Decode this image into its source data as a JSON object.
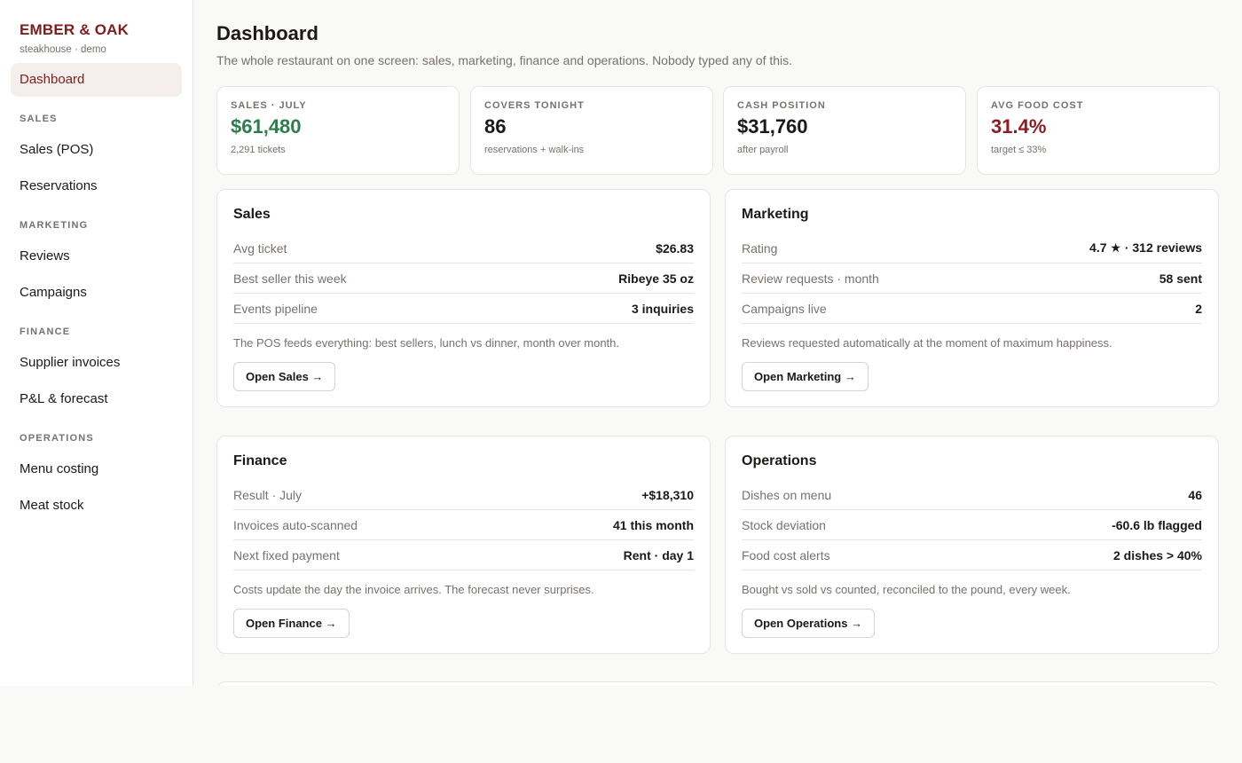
{
  "brand": {
    "name": "EMBER & OAK",
    "subtitle": "steakhouse · demo"
  },
  "sidebar": {
    "dashboard": "Dashboard",
    "sections": [
      {
        "title": "SALES",
        "items": [
          "Sales (POS)",
          "Reservations"
        ]
      },
      {
        "title": "MARKETING",
        "items": [
          "Reviews",
          "Campaigns"
        ]
      },
      {
        "title": "FINANCE",
        "items": [
          "Supplier invoices",
          "P&L & forecast"
        ]
      },
      {
        "title": "OPERATIONS",
        "items": [
          "Menu costing",
          "Meat stock"
        ]
      }
    ]
  },
  "page": {
    "title": "Dashboard",
    "subtitle": "The whole restaurant on one screen: sales, marketing, finance and operations. Nobody typed any of this."
  },
  "kpis": [
    {
      "label": "SALES · JULY",
      "value": "$61,480",
      "sub": "2,291 tickets",
      "tone": "green"
    },
    {
      "label": "COVERS TONIGHT",
      "value": "86",
      "sub": "reservations + walk-ins",
      "tone": "neutral"
    },
    {
      "label": "CASH POSITION",
      "value": "$31,760",
      "sub": "after payroll",
      "tone": "neutral"
    },
    {
      "label": "AVG FOOD COST",
      "value": "31.4%",
      "sub": "target ≤ 33%",
      "tone": "red"
    }
  ],
  "panels": [
    {
      "title": "Sales",
      "rows": [
        {
          "k": "Avg ticket",
          "v": "$26.83"
        },
        {
          "k": "Best seller this week",
          "v": "Ribeye 35 oz"
        },
        {
          "k": "Events pipeline",
          "v": "3 inquiries"
        }
      ],
      "note": "The POS feeds everything: best sellers, lunch vs dinner, month over month.",
      "button": "Open Sales →"
    },
    {
      "title": "Marketing",
      "rows": [
        {
          "k": "Rating",
          "v": "4.7 ★ · 312 reviews"
        },
        {
          "k": "Review requests · month",
          "v": "58 sent"
        },
        {
          "k": "Campaigns live",
          "v": "2"
        }
      ],
      "note": "Reviews requested automatically at the moment of maximum happiness.",
      "button": "Open Marketing →"
    },
    {
      "title": "Finance",
      "rows": [
        {
          "k": "Result · July",
          "v": "+$18,310"
        },
        {
          "k": "Invoices auto-scanned",
          "v": "41 this month"
        },
        {
          "k": "Next fixed payment",
          "v": "Rent · day 1"
        }
      ],
      "note": "Costs update the day the invoice arrives. The forecast never surprises.",
      "button": "Open Finance →"
    },
    {
      "title": "Operations",
      "rows": [
        {
          "k": "Dishes on menu",
          "v": "46"
        },
        {
          "k": "Stock deviation",
          "v": "-60.6 lb flagged"
        },
        {
          "k": "Food cost alerts",
          "v": "2 dishes > 40%"
        }
      ],
      "note": "Bought vs sold vs counted, reconciled to the pound, every week.",
      "button": "Open Operations →"
    }
  ],
  "colors": {
    "brand": "#7f1d1d",
    "positive": "#2f7d4f",
    "alert": "#8b1e23"
  }
}
